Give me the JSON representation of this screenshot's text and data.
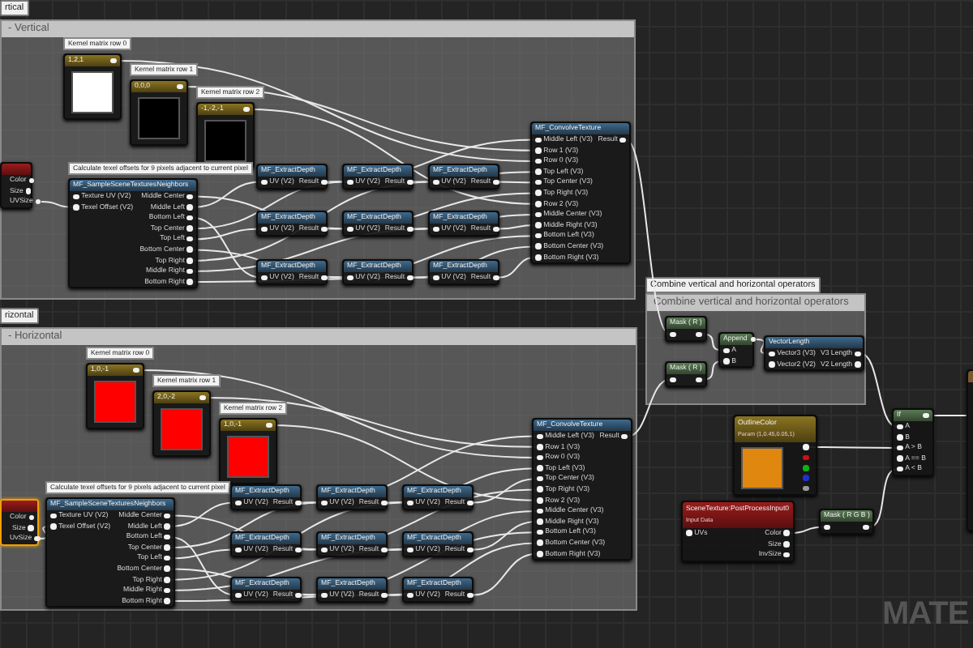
{
  "groups": [
    {
      "tab": "rtical",
      "title": "- Vertical",
      "nodes": [
        {
          "kind": "constant",
          "note": "Kernel matrix row 0",
          "title": "1,2,1",
          "color": "#ffffff",
          "selected": false
        },
        {
          "kind": "constant",
          "note": "Kernel matrix row 1",
          "title": "0,0,0",
          "color": "#000000",
          "selected": false
        },
        {
          "kind": "constant",
          "note": "Kernel matrix row 2",
          "title": "-1,-2,-1",
          "color": "#000000",
          "selected": false
        },
        {
          "kind": "param",
          "outputs": [
            "Color",
            "Size",
            "UVSize"
          ],
          "selected": false
        },
        {
          "kind": "function",
          "note": "Calculate texel offsets for 9 pixels adjacent to current pixel",
          "title": "MF_SampleSceneTexturesNeighbors",
          "inputs": [
            "Texture UV (V2)",
            "Texel Offset (V2)"
          ],
          "outputs": [
            "Middle Center",
            "Middle Left",
            "Bottom Left",
            "Top Center",
            "Top Left",
            "Bottom Center",
            "Top Right",
            "Middle Right",
            "Bottom Right"
          ],
          "selected": false
        },
        {
          "kind": "function",
          "title": "MF_ExtractDepth",
          "inputs": [
            "UV (V2)"
          ],
          "outputs": [
            "Result"
          ],
          "selected": false
        },
        {
          "kind": "function",
          "title": "MF_ExtractDepth",
          "inputs": [
            "UV (V2)"
          ],
          "outputs": [
            "Result"
          ],
          "selected": false
        },
        {
          "kind": "function",
          "title": "MF_ExtractDepth",
          "inputs": [
            "UV (V2)"
          ],
          "outputs": [
            "Result"
          ],
          "selected": false
        },
        {
          "kind": "function",
          "title": "MF_ExtractDepth",
          "inputs": [
            "UV (V2)"
          ],
          "outputs": [
            "Result"
          ],
          "selected": false
        },
        {
          "kind": "function",
          "title": "MF_ExtractDepth",
          "inputs": [
            "UV (V2)"
          ],
          "outputs": [
            "Result"
          ],
          "selected": false
        },
        {
          "kind": "function",
          "title": "MF_ExtractDepth",
          "inputs": [
            "UV (V2)"
          ],
          "outputs": [
            "Result"
          ],
          "selected": false
        },
        {
          "kind": "function",
          "title": "MF_ExtractDepth",
          "inputs": [
            "UV (V2)"
          ],
          "outputs": [
            "Result"
          ],
          "selected": false
        },
        {
          "kind": "function",
          "title": "MF_ExtractDepth",
          "inputs": [
            "UV (V2)"
          ],
          "outputs": [
            "Result"
          ],
          "selected": false
        },
        {
          "kind": "function",
          "title": "MF_ExtractDepth",
          "inputs": [
            "UV (V2)"
          ],
          "outputs": [
            "Result"
          ],
          "selected": false
        },
        {
          "kind": "function",
          "title": "MF_ConvolveTexture",
          "inputs": [
            "Middle Left (V3)",
            "Row 1 (V3)",
            "Row 0 (V3)",
            "Top Left (V3)",
            "Top Center (V3)",
            "Top Right (V3)",
            "Row 2 (V3)",
            "Middle Center (V3)",
            "Middle Right (V3)",
            "Bottom Left (V3)",
            "Bottom Center (V3)",
            "Bottom Right (V3)"
          ],
          "outputs": [
            "Result"
          ],
          "selected": false
        }
      ]
    },
    {
      "tab": "rizontal",
      "title": "- Horizontal",
      "nodes": [
        {
          "kind": "constant",
          "note": "Kernel matrix row 0",
          "title": "1,0,-1",
          "color": "#ff0000",
          "selected": false
        },
        {
          "kind": "constant",
          "note": "Kernel matrix row 1",
          "title": "2,0,-2",
          "color": "#ff0000",
          "selected": false
        },
        {
          "kind": "constant",
          "note": "Kernel matrix row 2",
          "title": "1,0,-1",
          "color": "#ff0000",
          "selected": false
        },
        {
          "kind": "param",
          "outputs": [
            "Color",
            "Size",
            "UvSize"
          ],
          "selected": true
        },
        {
          "kind": "function",
          "note": "Calculate texel offsets for 9 pixels adjacent to current pixel",
          "title": "MF_SampleSceneTexturesNeighbors",
          "inputs": [
            "Texture UV (V2)",
            "Texel Offset (V2)"
          ],
          "outputs": [
            "Middle Center",
            "Middle Left",
            "Bottom Left",
            "Top Center",
            "Top Left",
            "Bottom Center",
            "Top Right",
            "Middle Right",
            "Bottom Right"
          ],
          "selected": false
        },
        {
          "kind": "function",
          "title": "MF_ExtractDepth",
          "inputs": [
            "UV (V2)"
          ],
          "outputs": [
            "Result"
          ],
          "selected": false
        },
        {
          "kind": "function",
          "title": "MF_ExtractDepth",
          "inputs": [
            "UV (V2)"
          ],
          "outputs": [
            "Result"
          ],
          "selected": false
        },
        {
          "kind": "function",
          "title": "MF_ExtractDepth",
          "inputs": [
            "UV (V2)"
          ],
          "outputs": [
            "Result"
          ],
          "selected": false
        },
        {
          "kind": "function",
          "title": "MF_ExtractDepth",
          "inputs": [
            "UV (V2)"
          ],
          "outputs": [
            "Result"
          ],
          "selected": false
        },
        {
          "kind": "function",
          "title": "MF_ExtractDepth",
          "inputs": [
            "UV (V2)"
          ],
          "outputs": [
            "Result"
          ],
          "selected": false
        },
        {
          "kind": "function",
          "title": "MF_ExtractDepth",
          "inputs": [
            "UV (V2)"
          ],
          "outputs": [
            "Result"
          ],
          "selected": false
        },
        {
          "kind": "function",
          "title": "MF_ExtractDepth",
          "inputs": [
            "UV (V2)"
          ],
          "outputs": [
            "Result"
          ],
          "selected": false
        },
        {
          "kind": "function",
          "title": "MF_ExtractDepth",
          "inputs": [
            "UV (V2)"
          ],
          "outputs": [
            "Result"
          ],
          "selected": false
        },
        {
          "kind": "function",
          "title": "MF_ExtractDepth",
          "inputs": [
            "UV (V2)"
          ],
          "outputs": [
            "Result"
          ],
          "selected": false
        },
        {
          "kind": "function",
          "title": "MF_ConvolveTexture",
          "inputs": [
            "Middle Left (V3)",
            "Row 1 (V3)",
            "Row 0 (V3)",
            "Top Left (V3)",
            "Top Center (V3)",
            "Top Right (V3)",
            "Row 2 (V3)",
            "Middle Center (V3)",
            "Middle Right (V3)",
            "Bottom Left (V3)",
            "Bottom Center (V3)",
            "Bottom Right (V3)"
          ],
          "outputs": [
            "Result"
          ],
          "selected": false
        }
      ]
    },
    {
      "tab": "Combine vertical and horizontal operators",
      "title": "Combine vertical and horizontal operators",
      "nodes": [
        {
          "kind": "math",
          "title": "Mask ( R )",
          "selected": false
        },
        {
          "kind": "math",
          "title": "Mask ( R )",
          "selected": false
        },
        {
          "kind": "math",
          "title": "Append",
          "inputs": [
            "A",
            "B"
          ],
          "selected": false
        },
        {
          "kind": "function",
          "title": "VectorLength",
          "inputs": [
            "Vector3 (V3)",
            "Vector2 (V2)"
          ],
          "outputs": [
            "V3 Length",
            "V2 Length"
          ],
          "selected": false
        }
      ]
    }
  ],
  "nodes": [
    {
      "kind": "vector",
      "title": "OutlineColor",
      "subtitle": "Param (1,0.45,0.05,1)",
      "color": "#e0870f",
      "selected": false
    },
    {
      "kind": "math",
      "title": "If",
      "inputs": [
        "A",
        "B",
        "A > B",
        "A == B",
        "A < B"
      ],
      "selected": false
    },
    {
      "kind": "param",
      "title": "SceneTexture:PostProcessInput0",
      "subtitle": "Input Data",
      "inputs": [
        "UVs"
      ],
      "outputs": [
        "Color",
        "Size",
        "InvSize"
      ],
      "selected": false
    },
    {
      "kind": "math",
      "title": "Mask ( R G B )",
      "selected": false
    },
    {
      "kind": "stub",
      "selected": false
    }
  ],
  "graph_label": "MATE"
}
